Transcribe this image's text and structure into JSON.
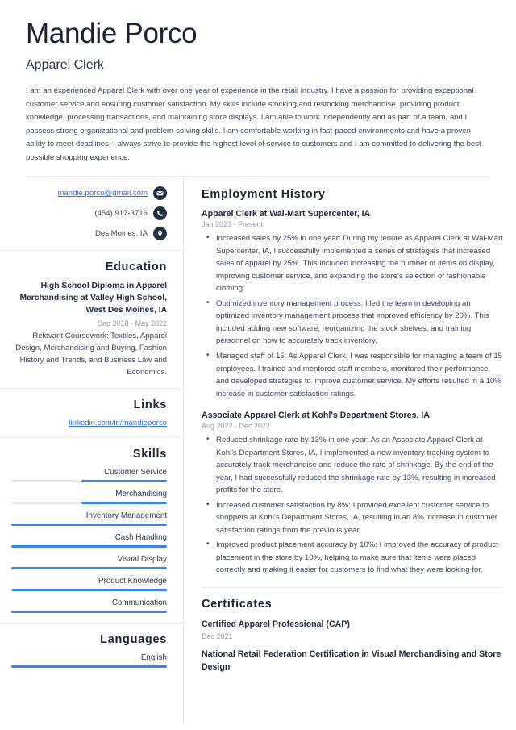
{
  "header": {
    "name": "Mandie Porco",
    "job_title": "Apparel Clerk",
    "summary": "I am an experienced Apparel Clerk with over one year of experience in the retail industry. I have a passion for providing exceptional customer service and ensuring customer satisfaction. My skills include stocking and restocking merchandise, providing product knowledge, processing transactions, and maintaining store displays. I am able to work independently and as part of a team, and I possess strong organizational and problem-solving skills. I am comfortable working in fast-paced environments and have a proven ability to meet deadlines. I always strive to provide the highest level of service to customers and I am committed to delivering the best possible shopping experience."
  },
  "contact": {
    "email": "mandie.porco@gmail.com",
    "email_icon": "envelope-icon",
    "phone": "(454) 917-3716",
    "phone_icon": "phone-icon",
    "location": "Des Moines, IA",
    "location_icon": "map-pin-icon"
  },
  "education": {
    "heading": "Education",
    "degree": "High School Diploma in Apparel Merchandising at Valley High School, West Des Moines, IA",
    "dates": "Sep 2018 - May 2022",
    "description": "Relevant Coursework: Textiles, Apparel Design, Merchandising and Buying, Fashion History and Trends, and Business Law and Economics."
  },
  "links": {
    "heading": "Links",
    "items": [
      {
        "label": "linkedin.com/in/mandieporco"
      }
    ]
  },
  "skills": {
    "heading": "Skills",
    "accent_color": "#3b82f6",
    "track_color": "#e8e8ea",
    "items": [
      {
        "label": "Customer Service",
        "level": 55
      },
      {
        "label": "Merchandising",
        "level": 55
      },
      {
        "label": "Inventory Management",
        "level": 100
      },
      {
        "label": "Cash Handling",
        "level": 100
      },
      {
        "label": "Visual Display",
        "level": 100
      },
      {
        "label": "Product Knowledge",
        "level": 100
      },
      {
        "label": "Communication",
        "level": 100
      }
    ]
  },
  "languages": {
    "heading": "Languages",
    "items": [
      {
        "label": "English",
        "level": 100
      }
    ]
  },
  "employment": {
    "heading": "Employment History",
    "jobs": [
      {
        "title": "Apparel Clerk at Wal-Mart Supercenter, IA",
        "dates": "Jan 2023 - Present",
        "bullets": [
          "Increased sales by 25% in one year: During my tenure as Apparel Clerk at Wal-Mart Supercenter, IA, I successfully implemented a series of strategies that increased sales of apparel by 25%. This included increasing the number of items on display, improving customer service, and expanding the store's selection of fashionable clothing.",
          "Optimized inventory management process: I led the team in developing an optimized inventory management process that improved efficiency by 20%. This included adding new software, reorganizing the stock shelves, and training personnel on how to accurately track inventory.",
          "Managed staff of 15: As Apparel Clerk, I was responsible for managing a team of 15 employees. I trained and mentored staff members, monitored their performance, and developed strategies to improve customer service. My efforts resulted in a 10% increase in customer satisfaction ratings."
        ]
      },
      {
        "title": "Associate Apparel Clerk at Kohl's Department Stores, IA",
        "dates": "Aug 2022 - Dec 2022",
        "bullets": [
          "Reduced shrinkage rate by 13% in one year: As an Associate Apparel Clerk at Kohl's Department Stores, IA, I implemented a new inventory tracking system to accurately track merchandise and reduce the rate of shrinkage. By the end of the year, I had successfully reduced the shrinkage rate by 13%, resulting in increased profits for the store.",
          "Increased customer satisfaction by 8%: I provided excellent customer service to shoppers at Kohl's Department Stores, IA, resulting in an 8% increase in customer satisfaction ratings from the previous year.",
          "Improved product placement accuracy by 10%: I improved the accuracy of product placement in the store by 10%, helping to make sure that items were placed correctly and making it easier for customers to find what they were looking for."
        ]
      }
    ]
  },
  "certificates": {
    "heading": "Certificates",
    "items": [
      {
        "title": "Certified Apparel Professional (CAP)",
        "date": "Dec 2021"
      },
      {
        "title": "National Retail Federation Certification in Visual Merchandising and Store Design",
        "date": ""
      }
    ]
  }
}
